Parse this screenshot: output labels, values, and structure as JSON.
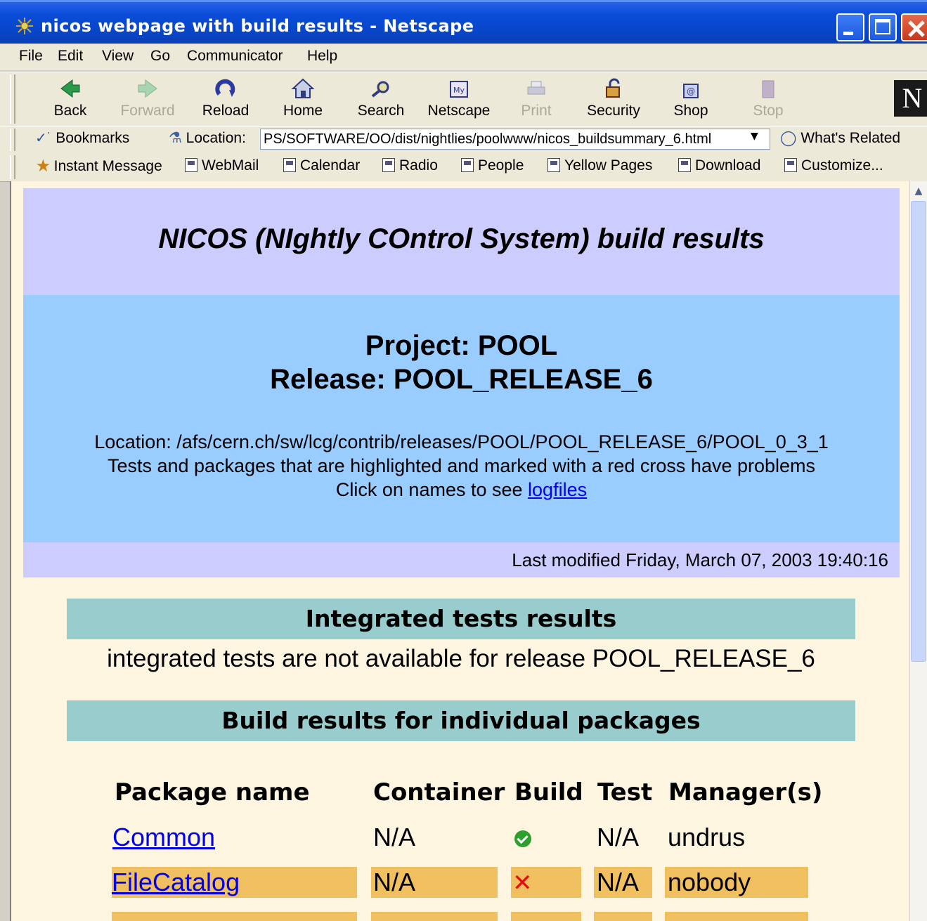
{
  "window": {
    "title": "nicos webpage with build results - Netscape"
  },
  "menu": [
    "File",
    "Edit",
    "View",
    "Go",
    "Communicator",
    "Help"
  ],
  "toolbar": {
    "back": "Back",
    "forward": "Forward",
    "reload": "Reload",
    "home": "Home",
    "search": "Search",
    "netscape": "Netscape",
    "print": "Print",
    "security": "Security",
    "shop": "Shop",
    "stop": "Stop"
  },
  "locationbar": {
    "bookmarks": "Bookmarks",
    "location_label": "Location:",
    "url": "PS/SOFTWARE/OO/dist/nightlies/poolwww/nicos_buildsummary_6.html",
    "whats_related": "What's Related"
  },
  "personal": [
    "Instant Message",
    "WebMail",
    "Calendar",
    "Radio",
    "People",
    "Yellow Pages",
    "Download",
    "Customize..."
  ],
  "page": {
    "title": "NICOS (NIghtly COntrol System) build results",
    "project": "Project: POOL",
    "release": "Release: POOL_RELEASE_6",
    "location": "Location: /afs/cern.ch/sw/lcg/contrib/releases/POOL/POOL_RELEASE_6/POOL_0_3_1",
    "tests_note": "Tests and packages that are highlighted and marked with a red cross have problems",
    "click_prefix": "Click on names to see",
    "click_link": "logfiles",
    "last_modified": "Last modified Friday, March 07, 2003 19:40:16",
    "integrated_header": "Integrated tests results",
    "integrated_msg": "integrated tests are not available for release POOL_RELEASE_6",
    "build_header": "Build results for individual packages",
    "columns": [
      "Package name",
      "Container",
      "Build",
      "Test",
      "Manager(s)"
    ],
    "rows": [
      {
        "name": "Common",
        "container": "N/A",
        "build": "ok",
        "test": "N/A",
        "manager": "undrus",
        "highlight": false
      },
      {
        "name": "FileCatalog",
        "container": "N/A",
        "build": "fail",
        "test": "N/A",
        "manager": "nobody",
        "highlight": true
      }
    ],
    "fail_glyph": "✕"
  },
  "colors": {
    "header_lavender": "#ccccff",
    "header_blue": "#99ccff",
    "section_teal": "#99cccc",
    "page_bg": "#fdf5e0",
    "row_highlight": "#f0c060"
  }
}
